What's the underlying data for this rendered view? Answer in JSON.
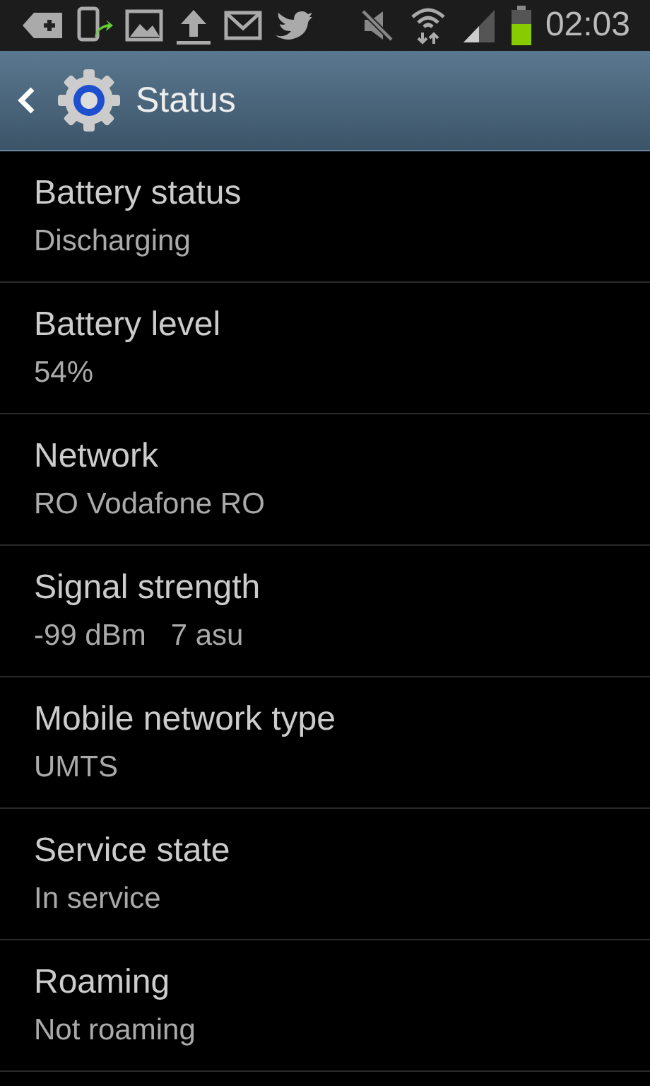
{
  "status_bar": {
    "time": "02:03"
  },
  "header": {
    "title": "Status"
  },
  "items": [
    {
      "label": "Battery status",
      "value": "Discharging"
    },
    {
      "label": "Battery level",
      "value": "54%"
    },
    {
      "label": "Network",
      "value": "RO Vodafone RO"
    },
    {
      "label": "Signal strength",
      "value": "-99 dBm   7 asu"
    },
    {
      "label": "Mobile network type",
      "value": "UMTS"
    },
    {
      "label": "Service state",
      "value": "In service"
    },
    {
      "label": "Roaming",
      "value": "Not roaming"
    }
  ]
}
